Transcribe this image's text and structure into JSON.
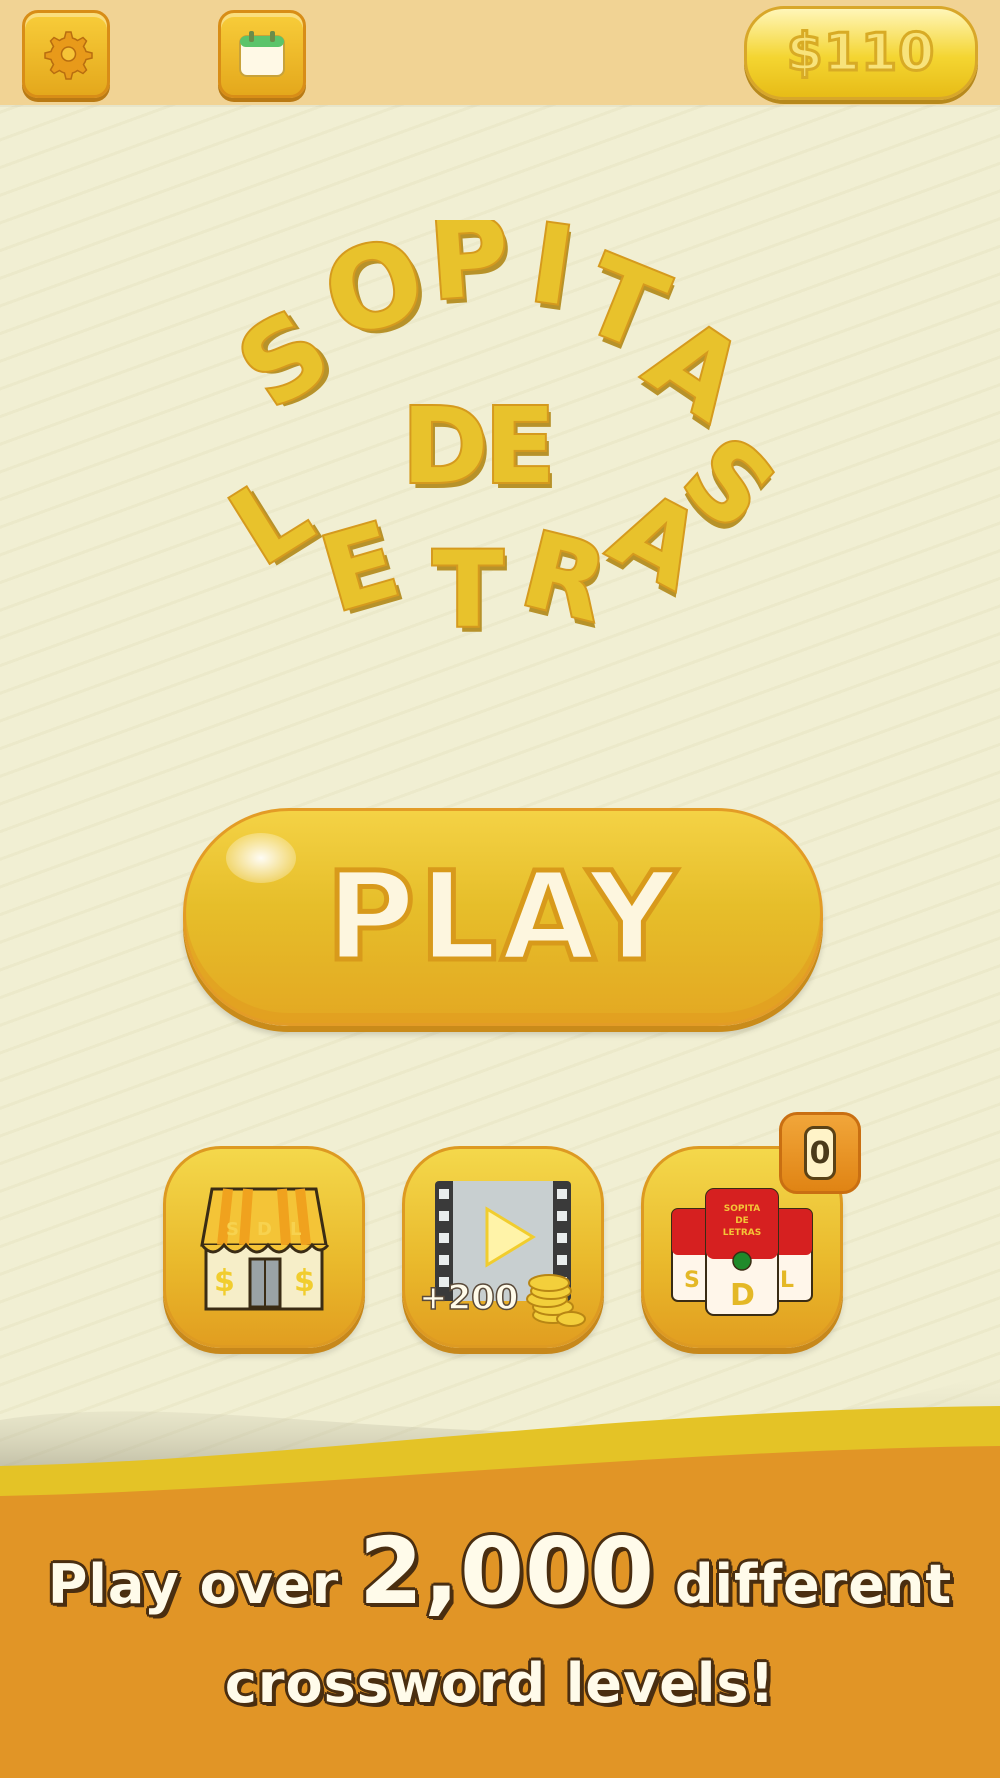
{
  "header": {
    "settings_icon": "gear-icon",
    "calendar_icon": "calendar-icon",
    "coins": "$110"
  },
  "logo": {
    "line1": [
      "S",
      "O",
      "P",
      "I",
      "T",
      "A"
    ],
    "line2": [
      "D",
      "E"
    ],
    "line3": [
      "L",
      "E",
      "T",
      "R",
      "A",
      "S"
    ]
  },
  "play_button": {
    "label": "PLAY"
  },
  "menu": {
    "shop": {
      "icon": "shop-icon",
      "awning_letters": [
        "S",
        "D",
        "L"
      ],
      "sign": "$"
    },
    "video": {
      "icon": "video-reward-icon",
      "reward": "+200"
    },
    "collection": {
      "icon": "soup-cans-icon",
      "can_title": [
        "SOPITA",
        "DE",
        "LETRAS"
      ],
      "can_letters": [
        "S",
        "D",
        "L"
      ],
      "badge_count": "0"
    }
  },
  "promo": {
    "prefix": "Play over",
    "number": "2,000",
    "suffix": "different",
    "line2": "crossword levels!"
  },
  "colors": {
    "background": "#f1efd3",
    "topbar": "#f1d394",
    "button_yellow": "#e9b82b",
    "footer_orange": "#e19526",
    "wave_yellow": "#e4c326"
  }
}
